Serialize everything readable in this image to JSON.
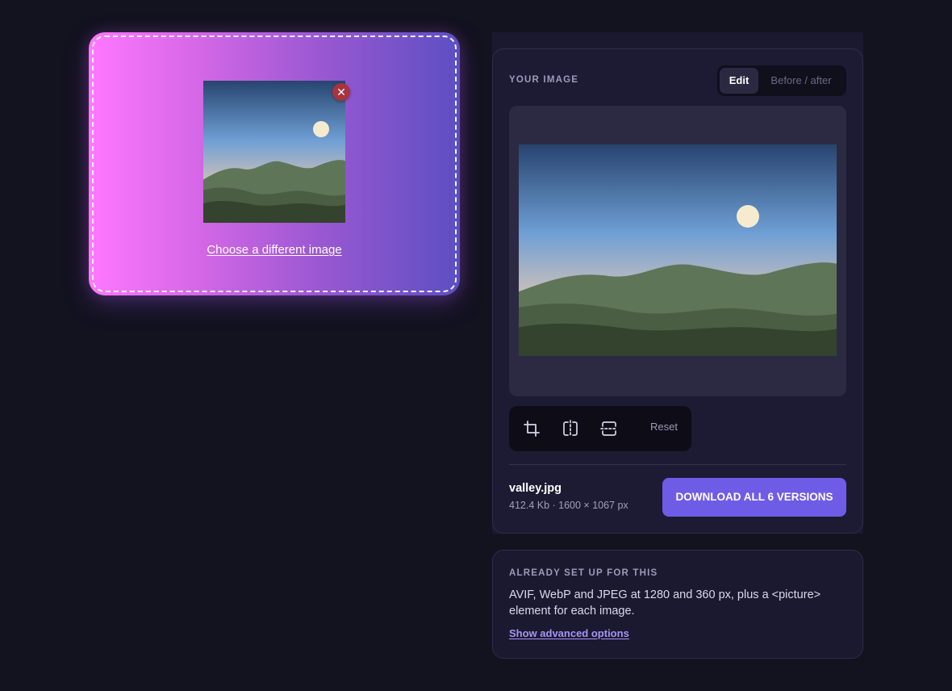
{
  "dropzone": {
    "choose_link": "Choose a different image",
    "remove_symbol": "✕"
  },
  "panel": {
    "label": "YOUR IMAGE",
    "tabs": [
      {
        "label": "Edit",
        "active": true
      },
      {
        "label": "Before / after",
        "active": false
      }
    ],
    "toolbar": {
      "tools": [
        "crop-icon",
        "flip-horizontal-icon",
        "flip-vertical-icon"
      ],
      "reset_label": "Reset"
    },
    "file": {
      "name": "valley.jpg",
      "meta": "412.4 Kb · 1600 × 1067 px"
    },
    "download_label": "DOWNLOAD ALL 6 VERSIONS"
  },
  "info": {
    "label": "ALREADY SET UP FOR THIS",
    "text": "AVIF, WebP and JPEG at 1280 and 360 px, plus a <picture> element for each image.",
    "link": "Show advanced options"
  },
  "colors": {
    "background": "#13121f",
    "accent": "#6f5ce6",
    "remove": "#a8343e",
    "link": "#a795f5"
  }
}
